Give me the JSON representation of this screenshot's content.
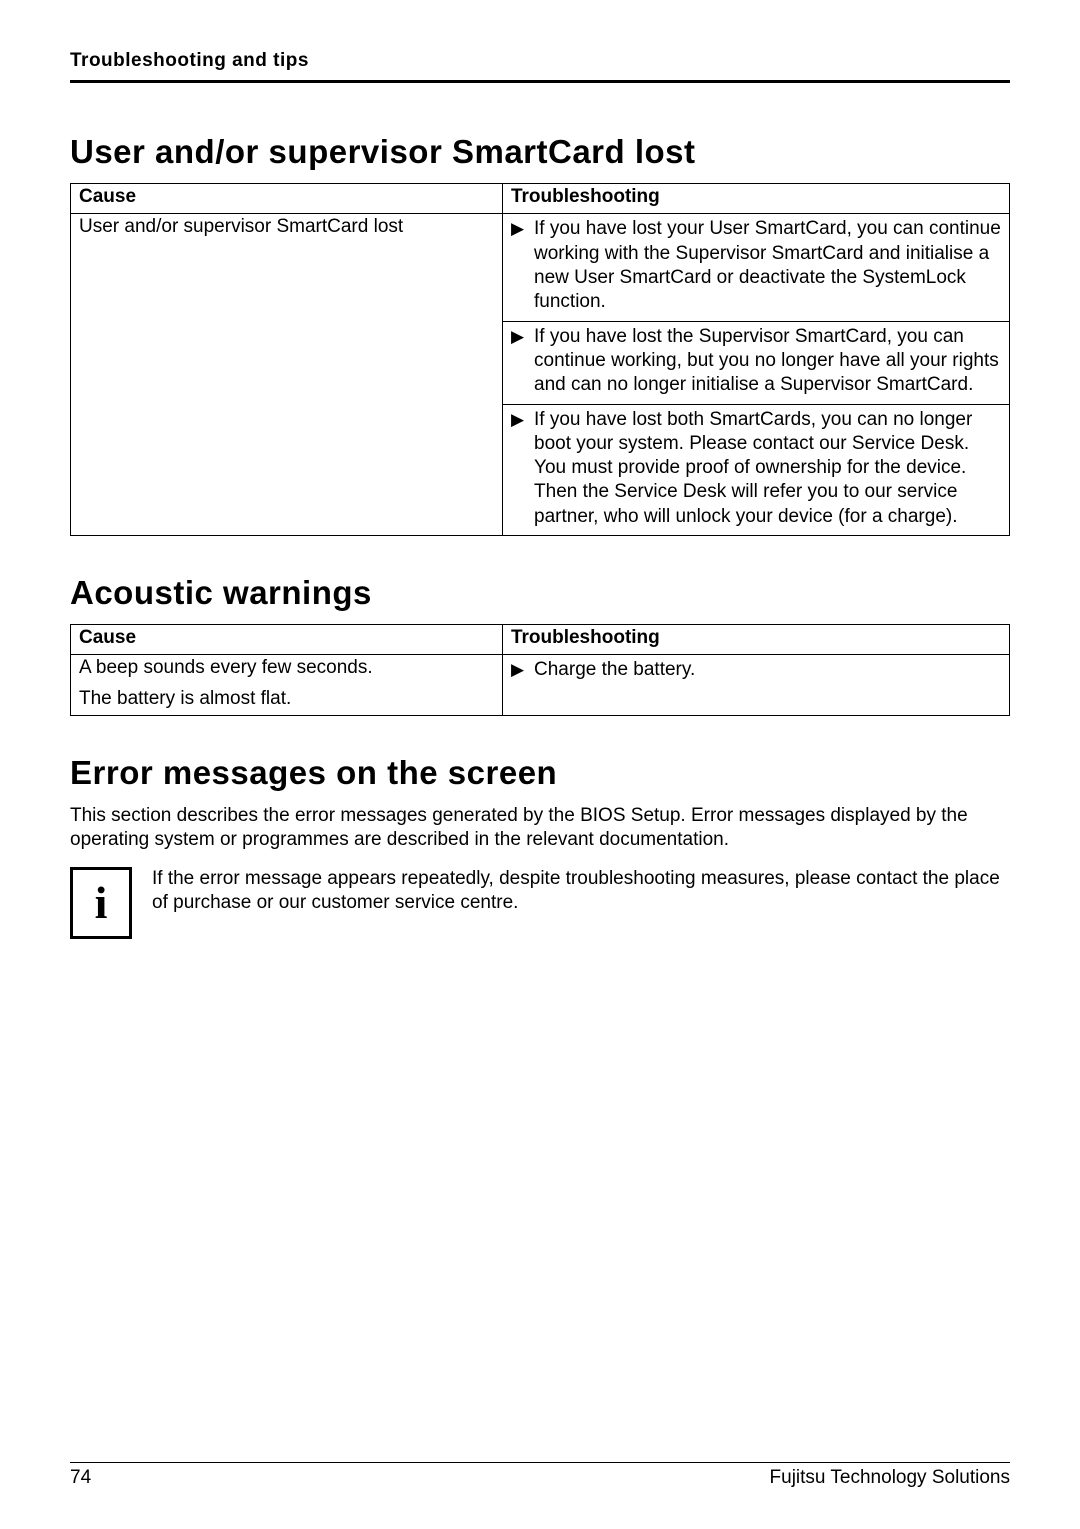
{
  "running_head": "Troubleshooting and tips",
  "section1": {
    "title": "User and/or supervisor SmartCard lost",
    "headers": {
      "cause": "Cause",
      "ts": "Troubleshooting"
    },
    "cause": "User and/or supervisor SmartCard lost",
    "steps": [
      "If you have lost your User SmartCard, you can continue working with the Supervisor SmartCard and initialise a new User SmartCard or deactivate the SystemLock function.",
      "If you have lost the Supervisor SmartCard, you can continue working, but you no longer have all your rights and can no longer initialise a Supervisor SmartCard.",
      "If you have lost both SmartCards, you can no longer boot your system. Please contact our Service Desk. You must provide proof of ownership for the device. Then the Service Desk will refer you to our service partner, who will unlock your device (for a charge)."
    ]
  },
  "section2": {
    "title": "Acoustic warnings",
    "headers": {
      "cause": "Cause",
      "ts": "Troubleshooting"
    },
    "cause_line1": "A beep sounds every few seconds.",
    "cause_line2": "The battery is almost flat.",
    "step": "Charge the battery."
  },
  "section3": {
    "title": "Error messages on the screen",
    "intro": "This section describes the error messages generated by the BIOS Setup. Error messages displayed by the operating system or programmes are described in the relevant documentation.",
    "note_icon": "i",
    "note": "If the error message appears repeatedly, despite troubleshooting measures, please contact the place of purchase or our customer service centre."
  },
  "footer": {
    "page": "74",
    "company": "Fujitsu Technology Solutions"
  },
  "glyphs": {
    "arrow": "▶"
  }
}
